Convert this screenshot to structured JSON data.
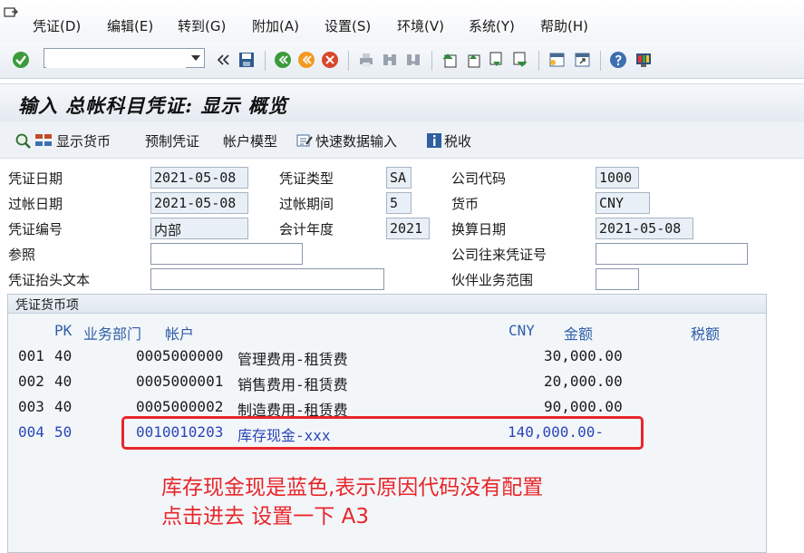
{
  "menu": {
    "items": [
      "凭证(D)",
      "编辑(E)",
      "转到(G)",
      "附加(A)",
      "设置(S)",
      "环境(V)",
      "系统(Y)",
      "帮助(H)"
    ]
  },
  "toolbar": {
    "command_value": "",
    "icons": [
      "check-icon",
      "back-arrows-icon",
      "save-icon",
      "back-icon",
      "exit-icon",
      "cancel-icon",
      "print-icon",
      "find-icon",
      "find-next-icon",
      "first-page-icon",
      "prev-page-icon",
      "next-page-icon",
      "last-page-icon",
      "new-session-icon",
      "shortcut-icon",
      "help-icon",
      "layout-icon"
    ]
  },
  "page": {
    "title": "输入 总帐科目凭证: 显示 概览"
  },
  "app_toolbar": {
    "display_currency": "显示货币",
    "park_document": "预制凭证",
    "account_model": "帐户模型",
    "fast_entry": "快速数据输入",
    "tax": "税收"
  },
  "header": {
    "doc_date_label": "凭证日期",
    "doc_date": "2021-05-08",
    "doc_type_label": "凭证类型",
    "doc_type": "SA",
    "company_code_label": "公司代码",
    "company_code": "1000",
    "posting_date_label": "过帐日期",
    "posting_date": "2021-05-08",
    "period_label": "过帐期间",
    "period": "5",
    "currency_label": "货币",
    "currency": "CNY",
    "doc_number_label": "凭证编号",
    "doc_number": "内部",
    "fiscal_year_label": "会计年度",
    "fiscal_year": "2021",
    "translation_date_label": "换算日期",
    "translation_date": "2021-05-08",
    "reference_label": "参照",
    "reference": "",
    "intercompany_label": "公司往来凭证号",
    "intercompany": "",
    "header_text_label": "凭证抬头文本",
    "header_text": "",
    "partner_ba_label": "伙伴业务范围",
    "partner_ba": ""
  },
  "items": {
    "group_title": "凭证货币项",
    "headers": {
      "pk": "PK",
      "ba": "业务部门",
      "account": "帐户",
      "currency": "CNY",
      "amount": "金额",
      "tax": "税额"
    },
    "rows": [
      {
        "no": "001",
        "pk": "40",
        "account": "0005000000",
        "desc": "管理费用-租赁费",
        "amount": "30,000.00"
      },
      {
        "no": "002",
        "pk": "40",
        "account": "0005000001",
        "desc": "销售费用-租赁费",
        "amount": "20,000.00"
      },
      {
        "no": "003",
        "pk": "40",
        "account": "0005000002",
        "desc": "制造费用-租赁费",
        "amount": "90,000.00"
      },
      {
        "no": "004",
        "pk": "50",
        "account": "0010010203",
        "desc": "库存现金-xxx",
        "amount": "140,000.00-"
      }
    ]
  },
  "annotation": {
    "line1": "库存现金现是蓝色,表示原因代码没有配置",
    "line2": "点击进去 设置一下 A3"
  },
  "colors": {
    "annotation": "#e8262a",
    "blue_row": "#2a45b8"
  }
}
